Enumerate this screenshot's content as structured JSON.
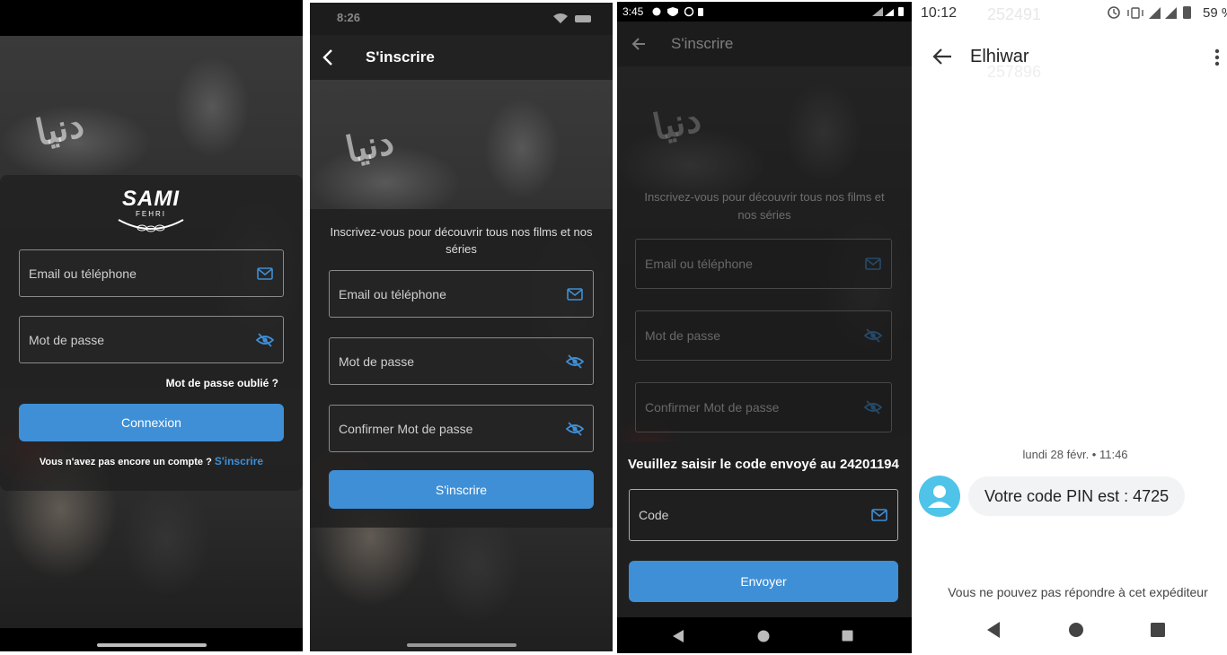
{
  "colors": {
    "accent": "#3f8fd6",
    "bg_dark": "#1c1c1c",
    "card": "#1e1e1e"
  },
  "screen1": {
    "logo_text": "SAMI",
    "logo_sub": "FEHRI",
    "email_placeholder": "Email ou téléphone",
    "password_placeholder": "Mot de passe",
    "forgot_label": "Mot de passe oublié ?",
    "login_button": "Connexion",
    "no_account_text": "Vous n'avez pas encore un compte ?",
    "signup_link": "S'inscrire"
  },
  "screen2": {
    "status_time": "8:26",
    "title": "S'inscrire",
    "subtitle": "Inscrivez-vous pour découvrir tous nos films et nos séries",
    "email_placeholder": "Email ou téléphone",
    "password_placeholder": "Mot de passe",
    "confirm_placeholder": "Confirmer Mot de passe",
    "signup_button": "S'inscrire"
  },
  "screen3": {
    "status_time": "3:45",
    "title": "S'inscrire",
    "subtitle": "Inscrivez-vous pour découvrir tous nos films et nos séries",
    "email_placeholder": "Email ou téléphone",
    "password_placeholder": "Mot de passe",
    "confirm_placeholder": "Confirmer Mot de passe",
    "dialog_title": "Veuillez saisir le code envoyé au 24201194",
    "code_placeholder": "Code",
    "send_button": "Envoyer"
  },
  "screen4": {
    "status_time": "10:12",
    "battery": "59 %",
    "contact_name": "Elhiwar",
    "bg_number_1": "252491",
    "bg_number_2": "257896",
    "date_label": "lundi 28 févr. • 11:46",
    "message": "Votre code PIN est : 4725",
    "no_reply": "Vous ne pouvez pas répondre à cet expéditeur"
  }
}
